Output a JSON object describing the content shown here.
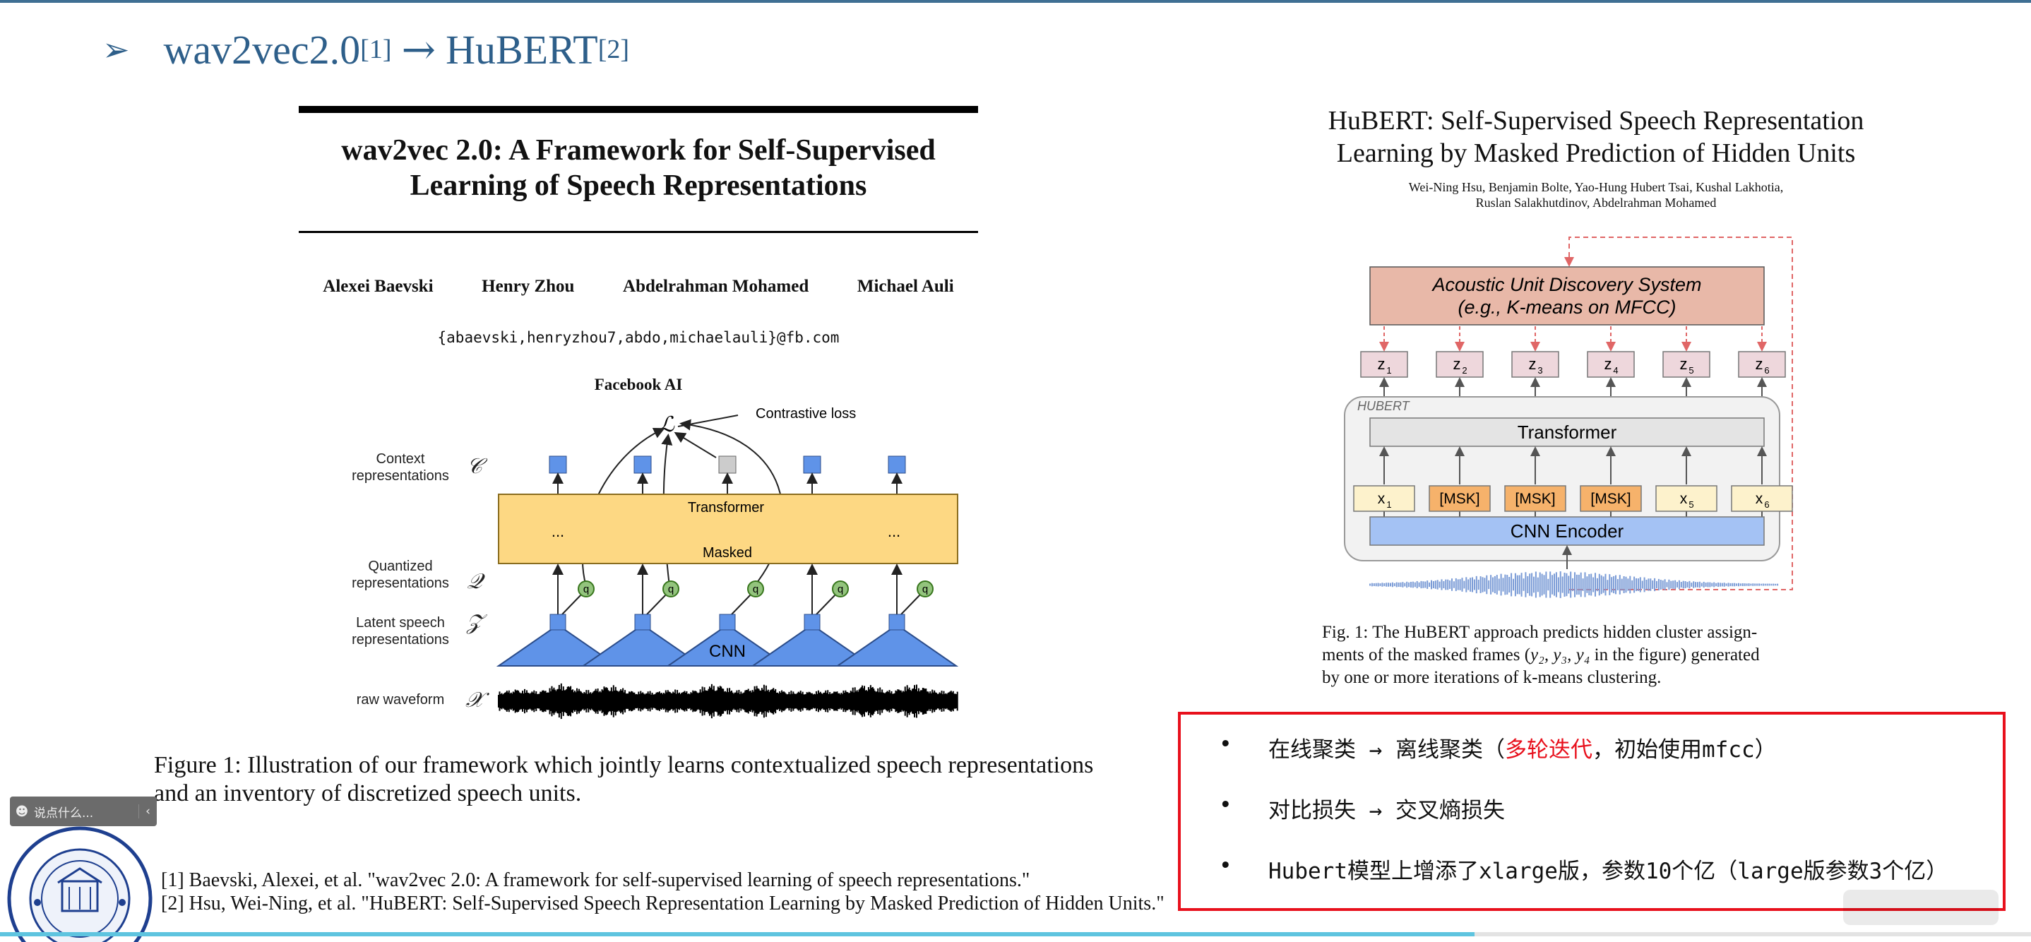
{
  "slide": {
    "title_main": "wav2vec2.0",
    "title_ref1": "[1]",
    "title_arrow": "→",
    "title_second": "HuBERT",
    "title_ref2": "[2]"
  },
  "left_paper": {
    "title_line1": "wav2vec 2.0: A Framework for Self-Supervised",
    "title_line2": "Learning of Speech Representations",
    "authors": [
      "Alexei Baevski",
      "Henry Zhou",
      "Abdelrahman Mohamed",
      "Michael Auli"
    ],
    "email": "{abaevski,henryzhou7,abdo,michaelauli}@fb.com",
    "affiliation": "Facebook AI",
    "figure": {
      "contrastive_label": "Contrastive loss",
      "loss_symbol": "ℒ",
      "rows": [
        {
          "label_line1": "Context",
          "label_line2": "representations",
          "symbol": "𝒞"
        },
        {
          "label_line1": "Quantized",
          "label_line2": "representations",
          "symbol": "𝒬"
        },
        {
          "label_line1": "Latent speech",
          "label_line2": "representations",
          "symbol": "𝒵"
        },
        {
          "label_line1": "raw waveform",
          "label_line2": "",
          "symbol": "𝒳"
        }
      ],
      "transformer_label": "Transformer",
      "masked_label": "Masked",
      "ellipsis": "...",
      "q_label": "q",
      "cnn_label": "CNN",
      "colors": {
        "context": "#5f93e8",
        "transformer": "#fdd883",
        "quantized": "#93c47d",
        "encoder": "#5f93e8",
        "masked": "#cccccc"
      }
    },
    "caption_line1": "Figure 1: Illustration of our framework which jointly learns contextualized speech representations",
    "caption_line2": "and an inventory of discretized speech units."
  },
  "references": [
    "[1] Baevski, Alexei, et al. \"wav2vec 2.0: A framework for self-supervised learning of speech representations.\"",
    "[2] Hsu, Wei-Ning, et al. \"HuBERT: Self-Supervised Speech Representation Learning by Masked Prediction of Hidden Units.\""
  ],
  "right_paper": {
    "title_line1": "HuBERT: Self-Supervised Speech Representation",
    "title_line2": "Learning by Masked Prediction of Hidden Units",
    "authors_line1": "Wei-Ning Hsu, Benjamin Bolte, Yao-Hung Hubert Tsai, Kushal Lakhotia,",
    "authors_line2": "Ruslan Salakhutdinov, Abdelrahman Mohamed",
    "figure": {
      "acoustic_line1": "Acoustic Unit Discovery System",
      "acoustic_line2": "(e.g., K-means on MFCC)",
      "z_labels": [
        "z",
        "z",
        "z",
        "z",
        "z",
        "z"
      ],
      "z_subs": [
        "1",
        "2",
        "3",
        "4",
        "5",
        "6"
      ],
      "hubert_label": "HUBERT",
      "transformer_label": "Transformer",
      "inputs": [
        {
          "text": "x",
          "sub": "1",
          "masked": false
        },
        {
          "text": "[MSK]",
          "sub": "",
          "masked": true
        },
        {
          "text": "[MSK]",
          "sub": "",
          "masked": true
        },
        {
          "text": "[MSK]",
          "sub": "",
          "masked": true
        },
        {
          "text": "x",
          "sub": "5",
          "masked": false
        },
        {
          "text": "x",
          "sub": "6",
          "masked": false
        }
      ],
      "cnn_label": "CNN Encoder",
      "colors": {
        "acoustic": "#e8b8a8",
        "z_box": "#eed7dc",
        "transformer": "#e4e4e4",
        "input": "#fdf2cc",
        "mask": "#f6b26b",
        "cnn": "#a4c2f4",
        "dashed": "#e06666"
      }
    },
    "caption_line1": "Fig. 1: The HuBERT approach predicts hidden cluster assign-",
    "caption_line2_pre": "ments of the masked frames (",
    "caption_line2_math": "y₂, y₃, y₄",
    "caption_line2_post": " in the figure) generated",
    "caption_line3": "by one or more iterations of k-means clustering."
  },
  "notes": {
    "bullet": "•",
    "items": [
      {
        "pre": "在线聚类 → 离线聚类（",
        "red": "多轮迭代",
        "post": "，初始使用mfcc）"
      },
      {
        "pre": "对比损失 → 交叉熵损失",
        "red": "",
        "post": ""
      },
      {
        "pre": "Hubert模型上增添了xlarge版，参数10个亿（large版参数3个亿）",
        "red": "",
        "post": ""
      }
    ],
    "border_color": "#e8101c"
  },
  "player": {
    "comment_placeholder": "说点什么...",
    "collapse_glyph": "‹",
    "progress": 0.726
  }
}
